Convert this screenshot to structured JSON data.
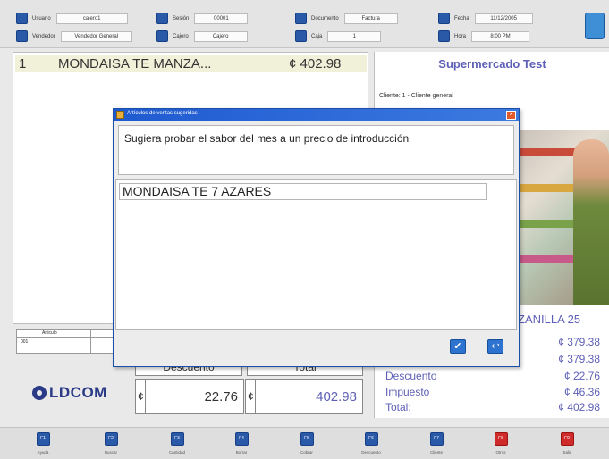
{
  "topbar": {
    "row1": [
      {
        "label": "Usuario",
        "value": "cajero1"
      },
      {
        "label": "Sesión",
        "value": "00001"
      },
      {
        "label": "Documento",
        "value": "Factura"
      },
      {
        "label": "Fecha",
        "value": "11/12/2005"
      }
    ],
    "row2": [
      {
        "label": "Vendedor",
        "value": "Vendedor General"
      },
      {
        "label": "Cajero",
        "value": "Cajero"
      },
      {
        "label": "Caja",
        "value": "1"
      },
      {
        "label": "Hora",
        "value": "8:00 PM"
      }
    ]
  },
  "item_list": {
    "rows": [
      {
        "index": "1",
        "description": "MONDAISA TE MANZA...",
        "amount": "¢ 402.98"
      }
    ]
  },
  "right_panel": {
    "store_name": "Supermercado Test",
    "client_label": "Cliente: 1 - Cliente general",
    "product_name": "ZANILLA 25",
    "subtotal_1": "¢ 379.38",
    "subtotal_2": "¢ 379.38",
    "discount_label": "Descuento",
    "discount_value": "¢ 22.76",
    "tax_label": "Impuesto",
    "tax_value": "¢ 46.36",
    "total_label": "Total:",
    "total_value": "¢ 402.98"
  },
  "small_grid": {
    "header": "Articulo",
    "cell": "001"
  },
  "logo": {
    "text": "LDCOM"
  },
  "summary": {
    "discount_header": "Descuento",
    "total_header": "Total",
    "currency": "¢",
    "discount_value": "22.76",
    "total_value": "402.98"
  },
  "function_keys": [
    {
      "key": "F1",
      "label": "Ayuda"
    },
    {
      "key": "F2",
      "label": "Buscar"
    },
    {
      "key": "F3",
      "label": "Cantidad"
    },
    {
      "key": "F4",
      "label": "Borrar"
    },
    {
      "key": "F5",
      "label": "Cobrar"
    },
    {
      "key": "F6",
      "label": "Descuento"
    },
    {
      "key": "F7",
      "label": "Cliente"
    },
    {
      "key": "F8",
      "label": "Otros"
    },
    {
      "key": "F9",
      "label": "Salir"
    }
  ],
  "dialog": {
    "title": "Artículos de ventas sugeridas",
    "close_symbol": "×",
    "message": "Sugiera probar el sabor del mes a un precio de introducción",
    "suggestion": "MONDAISA TE 7 AZARES",
    "ok_symbol": "✔",
    "cancel_symbol": "↩"
  },
  "colors": {
    "accent_blue": "#2a59a8",
    "highlight_purple": "#5d5fb6",
    "dialog_title": "#1f5ad0",
    "row_highlight": "#f1f0d8",
    "exit_red": "#d02b2b"
  }
}
